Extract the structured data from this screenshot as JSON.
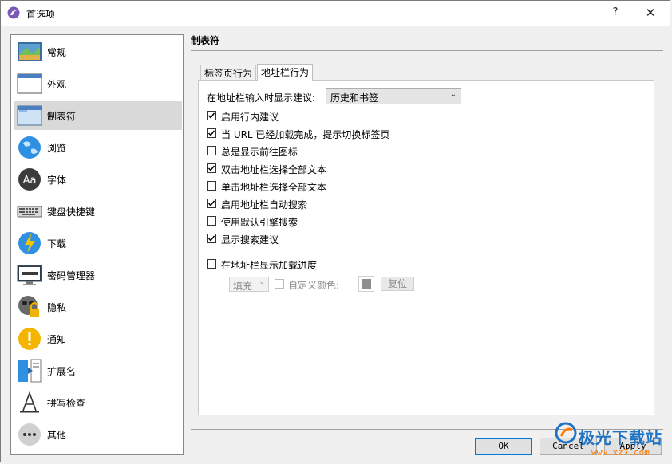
{
  "window": {
    "title": "首选项",
    "help": "?",
    "close": "✕"
  },
  "sidebar": {
    "items": [
      {
        "label": "常规",
        "icon": "general-settings-icon"
      },
      {
        "label": "外观",
        "icon": "appearance-window-icon"
      },
      {
        "label": "制表符",
        "icon": "tabs-window-icon",
        "selected": true
      },
      {
        "label": "浏览",
        "icon": "globe-icon"
      },
      {
        "label": "字体",
        "icon": "font-aa-icon"
      },
      {
        "label": "键盘快捷键",
        "icon": "keyboard-icon"
      },
      {
        "label": "下载",
        "icon": "download-globe-icon"
      },
      {
        "label": "密码管理器",
        "icon": "monitor-password-icon"
      },
      {
        "label": "隐私",
        "icon": "privacy-lock-icon"
      },
      {
        "label": "通知",
        "icon": "notification-exclamation-icon"
      },
      {
        "label": "扩展名",
        "icon": "puzzle-extension-icon"
      },
      {
        "label": "拼写检查",
        "icon": "spellcheck-a-icon"
      },
      {
        "label": "其他",
        "icon": "more-dots-icon"
      }
    ]
  },
  "main": {
    "section_title": "制表符",
    "tabs": [
      {
        "label": "标签页行为",
        "active": false
      },
      {
        "label": "地址栏行为",
        "active": true
      }
    ],
    "suggest_label": "在地址栏输入时显示建议:",
    "suggest_value": "历史和书签",
    "options": [
      {
        "label": "启用行内建议",
        "checked": true
      },
      {
        "label": "当 URL 已经加载完成，提示切换标签页",
        "checked": true
      },
      {
        "label": "总是显示前往图标",
        "checked": false
      },
      {
        "label": "双击地址栏选择全部文本",
        "checked": true
      },
      {
        "label": "单击地址栏选择全部文本",
        "checked": false
      },
      {
        "label": "启用地址栏自动搜索",
        "checked": true
      },
      {
        "label": "使用默认引擎搜索",
        "checked": false
      },
      {
        "label": "显示搜索建议",
        "checked": true
      }
    ],
    "progress_option": {
      "label": "在地址栏显示加载进度",
      "checked": false
    },
    "progress_style_value": "填充",
    "custom_color_label": "自定义颜色:",
    "reset_label": "复位",
    "swatch_color": "#8e8e8e"
  },
  "footer": {
    "ok": "OK",
    "cancel": "Cancel",
    "apply": "Apply"
  },
  "watermark": {
    "text": "极光下载站",
    "url": "www.xz7.com"
  }
}
